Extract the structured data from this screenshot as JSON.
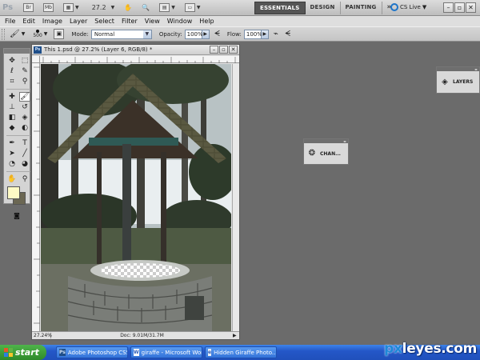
{
  "appbar": {
    "logo": "Ps",
    "bridge": "Br",
    "minibridge": "Mb",
    "zoom": "27.2",
    "workspaces": [
      "ESSENTIALS",
      "DESIGN",
      "PAINTING"
    ],
    "more": "»",
    "cslive": "CS Live"
  },
  "menu": [
    "File",
    "Edit",
    "Image",
    "Layer",
    "Select",
    "Filter",
    "View",
    "Window",
    "Help"
  ],
  "options": {
    "brush_size": "500",
    "mode_label": "Mode:",
    "mode_value": "Normal",
    "opacity_label": "Opacity:",
    "opacity_value": "100%",
    "flow_label": "Flow:",
    "flow_value": "100%"
  },
  "document": {
    "title": "This 1.psd @ 27.2% (Layer 6, RGB/8) *",
    "zoom": "27.24%",
    "doc_info": "Doc: 9.01M/31.7M"
  },
  "panels": {
    "layers": "LAYERS",
    "channels": "CHAN..."
  },
  "colors": {
    "foreground": "#fefac5",
    "background": "#6b6753"
  },
  "taskbar": {
    "start": "start",
    "tasks": [
      "Adobe Photoshop CS5",
      "giraffe - Microsoft Word",
      "Hidden Giraffe Photo..."
    ],
    "watermark_a": "px",
    "watermark_b": "leyes.com"
  }
}
